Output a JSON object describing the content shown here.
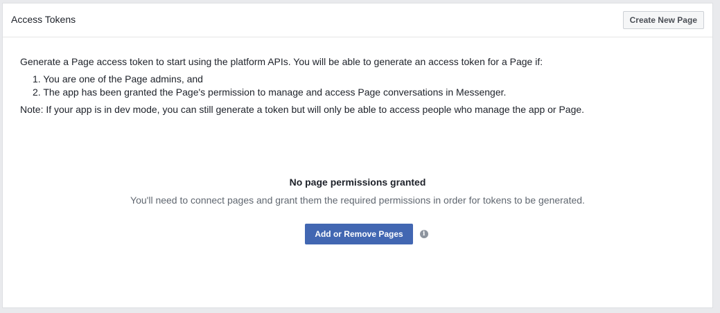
{
  "header": {
    "title": "Access Tokens",
    "create_button_label": "Create New Page"
  },
  "content": {
    "intro": "Generate a Page access token to start using the platform APIs. You will be able to generate an access token for a Page if:",
    "steps": [
      "1. You are one of the Page admins, and",
      "2. The app has been granted the Page's permission to manage and access Page conversations in Messenger."
    ],
    "note": "Note: If your app is in dev mode, you can still generate a token but will only be able to access people who manage the app or Page."
  },
  "empty_state": {
    "title": "No page permissions granted",
    "subtitle": "You'll need to connect pages and grant them the required permissions in order for tokens to be generated.",
    "button_label": "Add or Remove Pages",
    "info_icon": "info-icon"
  },
  "colors": {
    "primary": "#4267b2",
    "panel_bg": "#ffffff",
    "page_bg": "#e9eaed"
  }
}
